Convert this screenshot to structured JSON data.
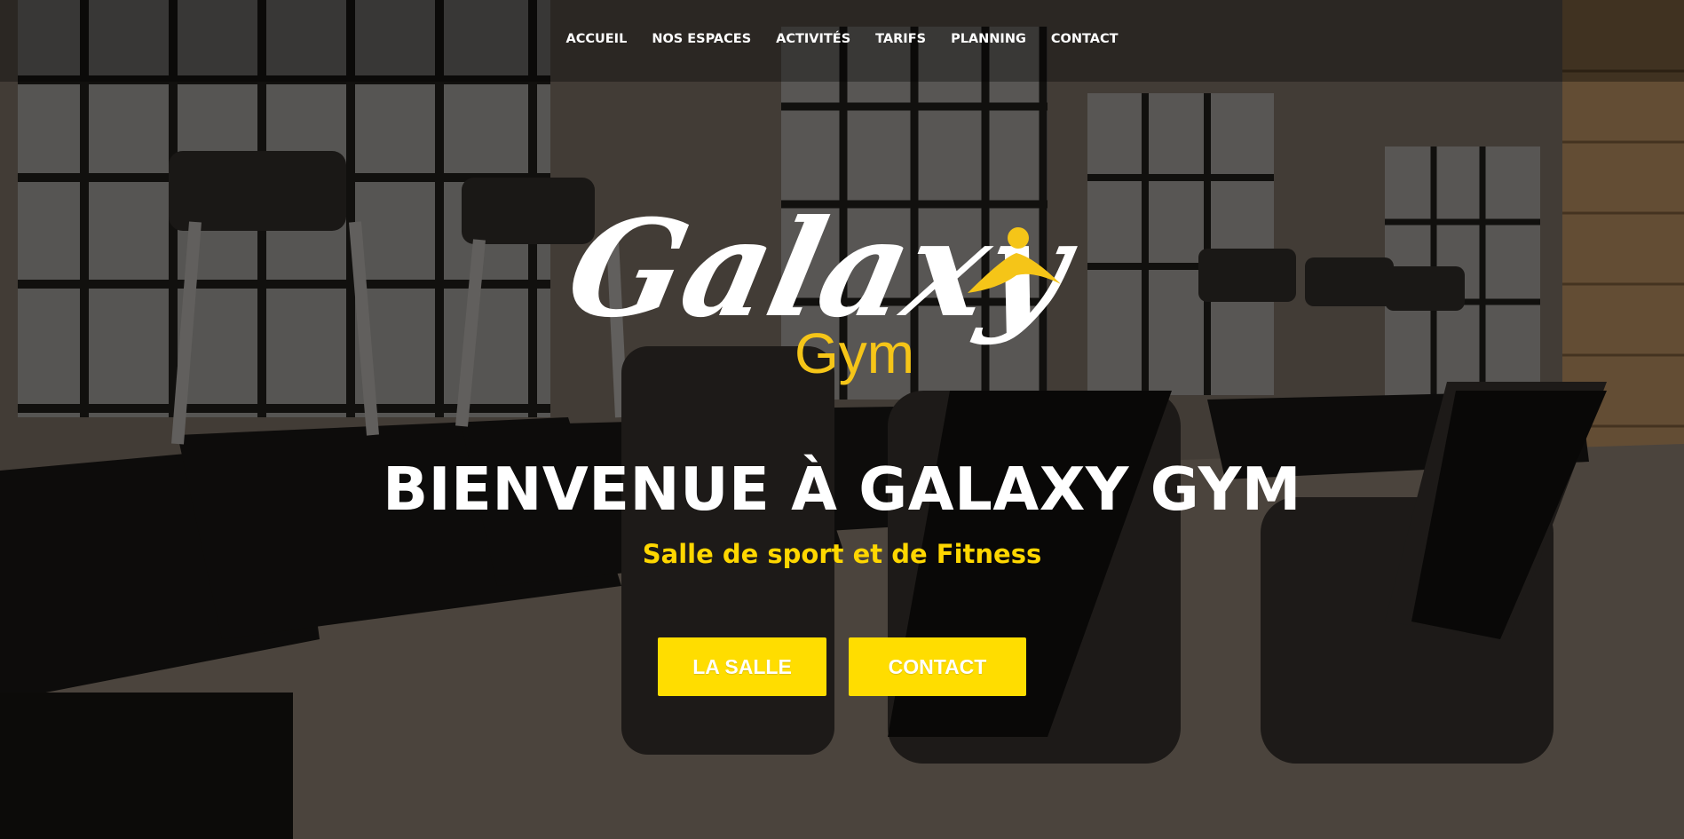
{
  "nav": {
    "items": [
      {
        "label": "ACCUEIL"
      },
      {
        "label": "NOS ESPACES"
      },
      {
        "label": "ACTIVITÉS"
      },
      {
        "label": "TARIFS"
      },
      {
        "label": "PLANNING"
      },
      {
        "label": "CONTACT"
      }
    ]
  },
  "logo": {
    "script_text": "Galaxy",
    "sub_text": "Gym",
    "script_color": "#ffffff",
    "accent_color": "#f5c518"
  },
  "hero": {
    "title": "BIENVENUE À GALAXY GYM",
    "subtitle": "Salle de sport et de Fitness",
    "buttons": {
      "salle_label": "LA SALLE",
      "contact_label": "CONTACT"
    }
  },
  "colors": {
    "accent": "#ffdd00",
    "subtitle": "#ffd700",
    "nav_text": "#ffffff"
  }
}
